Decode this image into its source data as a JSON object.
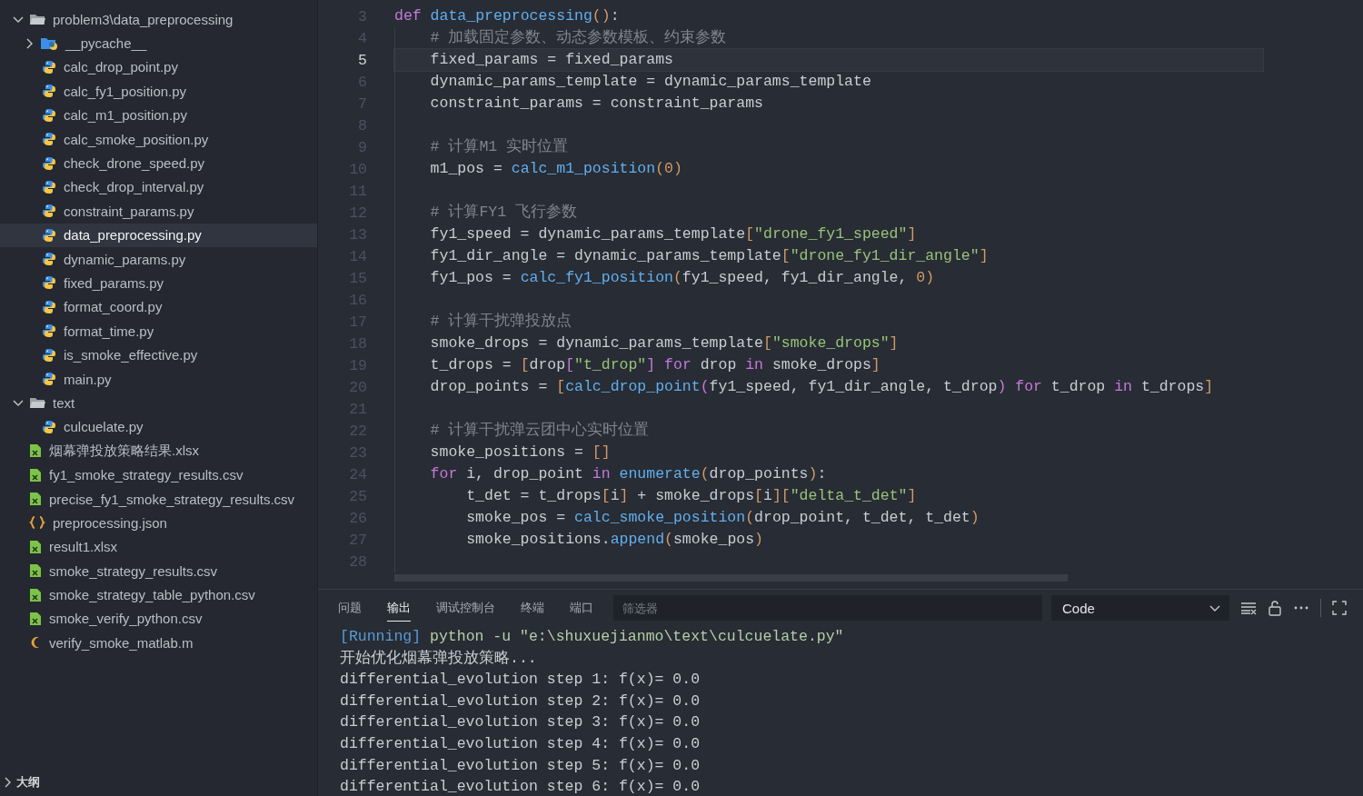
{
  "explorer": {
    "items": [
      {
        "kind": "folder",
        "label": "problem3\\data_preprocessing",
        "expanded": true,
        "selected": false,
        "children": [
          {
            "kind": "python-folder",
            "label": "__pycache__",
            "expanded": false,
            "selected": false
          },
          {
            "kind": "python",
            "label": "calc_drop_point.py",
            "selected": false
          },
          {
            "kind": "python",
            "label": "calc_fy1_position.py",
            "selected": false
          },
          {
            "kind": "python",
            "label": "calc_m1_position.py",
            "selected": false
          },
          {
            "kind": "python",
            "label": "calc_smoke_position.py",
            "selected": false
          },
          {
            "kind": "python",
            "label": "check_drone_speed.py",
            "selected": false
          },
          {
            "kind": "python",
            "label": "check_drop_interval.py",
            "selected": false
          },
          {
            "kind": "python",
            "label": "constraint_params.py",
            "selected": false
          },
          {
            "kind": "python",
            "label": "data_preprocessing.py",
            "selected": true
          },
          {
            "kind": "python",
            "label": "dynamic_params.py",
            "selected": false
          },
          {
            "kind": "python",
            "label": "fixed_params.py",
            "selected": false
          },
          {
            "kind": "python",
            "label": "format_coord.py",
            "selected": false
          },
          {
            "kind": "python",
            "label": "format_time.py",
            "selected": false
          },
          {
            "kind": "python",
            "label": "is_smoke_effective.py",
            "selected": false
          },
          {
            "kind": "python",
            "label": "main.py",
            "selected": false
          }
        ]
      },
      {
        "kind": "folder",
        "label": "text",
        "expanded": true,
        "selected": false,
        "children": [
          {
            "kind": "python",
            "label": "culcuelate.py",
            "selected": false
          }
        ]
      },
      {
        "kind": "excel",
        "label": "烟幕弹投放策略结果.xlsx",
        "selected": false
      },
      {
        "kind": "excel",
        "label": "fy1_smoke_strategy_results.csv",
        "selected": false
      },
      {
        "kind": "excel",
        "label": "precise_fy1_smoke_strategy_results.csv",
        "selected": false
      },
      {
        "kind": "json",
        "label": "preprocessing.json",
        "selected": false
      },
      {
        "kind": "excel",
        "label": "result1.xlsx",
        "selected": false
      },
      {
        "kind": "excel",
        "label": "smoke_strategy_results.csv",
        "selected": false
      },
      {
        "kind": "excel",
        "label": "smoke_strategy_table_python.csv",
        "selected": false
      },
      {
        "kind": "excel",
        "label": "smoke_verify_python.csv",
        "selected": false
      },
      {
        "kind": "matlab",
        "label": "verify_smoke_matlab.m",
        "selected": false
      }
    ],
    "outline": {
      "label": "大纲",
      "expanded": false
    }
  },
  "editor": {
    "lines": [
      {
        "number": "3",
        "current": false,
        "tokens": [
          {
            "kind": "kw",
            "t": "def"
          },
          {
            "kind": "fn",
            "t": " data_preprocessing"
          },
          {
            "kind": "br",
            "t": "()"
          },
          {
            "kind": "pl",
            "t": ":"
          }
        ]
      },
      {
        "number": "4",
        "current": false,
        "tokens": [
          {
            "kind": "cm",
            "t": "    # 加载固定参数、动态参数模板、约束参数"
          }
        ]
      },
      {
        "number": "5",
        "current": true,
        "tokens": [
          {
            "kind": "pl",
            "t": "    fixed_params = fixed_params"
          }
        ]
      },
      {
        "number": "6",
        "current": false,
        "tokens": [
          {
            "kind": "pl",
            "t": "    dynamic_params_template = dynamic_params_template"
          }
        ]
      },
      {
        "number": "7",
        "current": false,
        "tokens": [
          {
            "kind": "pl",
            "t": "    constraint_params = constraint_params"
          }
        ]
      },
      {
        "number": "8",
        "current": false
      },
      {
        "number": "9",
        "current": false,
        "tokens": [
          {
            "kind": "cm",
            "t": "    # 计算M1 实时位置"
          }
        ]
      },
      {
        "number": "10",
        "current": false,
        "tokens": [
          {
            "kind": "pl",
            "t": "    m1_pos = "
          },
          {
            "kind": "fn",
            "t": "calc_m1_position"
          },
          {
            "kind": "br",
            "t": "("
          },
          {
            "kind": "num",
            "t": "0"
          },
          {
            "kind": "br",
            "t": ")"
          }
        ]
      },
      {
        "number": "11",
        "current": false
      },
      {
        "number": "12",
        "current": false,
        "tokens": [
          {
            "kind": "cm",
            "t": "    # 计算FY1 飞行参数"
          }
        ]
      },
      {
        "number": "13",
        "current": false,
        "tokens": [
          {
            "kind": "pl",
            "t": "    fy1_speed = dynamic_params_template"
          },
          {
            "kind": "br",
            "t": "["
          },
          {
            "kind": "str",
            "t": "\"drone_fy1_speed\""
          },
          {
            "kind": "br",
            "t": "]"
          }
        ]
      },
      {
        "number": "14",
        "current": false,
        "tokens": [
          {
            "kind": "pl",
            "t": "    fy1_dir_angle = dynamic_params_template"
          },
          {
            "kind": "br",
            "t": "["
          },
          {
            "kind": "str",
            "t": "\"drone_fy1_dir_angle\""
          },
          {
            "kind": "br",
            "t": "]"
          }
        ]
      },
      {
        "number": "15",
        "current": false,
        "tokens": [
          {
            "kind": "pl",
            "t": "    fy1_pos = "
          },
          {
            "kind": "fn",
            "t": "calc_fy1_position"
          },
          {
            "kind": "br",
            "t": "("
          },
          {
            "kind": "pl",
            "t": "fy1_speed, fy1_dir_angle, "
          },
          {
            "kind": "num",
            "t": "0"
          },
          {
            "kind": "br",
            "t": ")"
          }
        ]
      },
      {
        "number": "16",
        "current": false
      },
      {
        "number": "17",
        "current": false,
        "tokens": [
          {
            "kind": "cm",
            "t": "    # 计算干扰弹投放点"
          }
        ]
      },
      {
        "number": "18",
        "current": false,
        "tokens": [
          {
            "kind": "pl",
            "t": "    smoke_drops = dynamic_params_template"
          },
          {
            "kind": "br",
            "t": "["
          },
          {
            "kind": "str",
            "t": "\"smoke_drops\""
          },
          {
            "kind": "br",
            "t": "]"
          }
        ]
      },
      {
        "number": "19",
        "current": false,
        "tokens": [
          {
            "kind": "pl",
            "t": "    t_drops = "
          },
          {
            "kind": "br",
            "t": "["
          },
          {
            "kind": "pl",
            "t": "drop"
          },
          {
            "kind": "br2",
            "t": "["
          },
          {
            "kind": "str",
            "t": "\"t_drop\""
          },
          {
            "kind": "br2",
            "t": "]"
          },
          {
            "kind": "kw",
            "t": " for"
          },
          {
            "kind": "pl",
            "t": " drop "
          },
          {
            "kind": "kw",
            "t": "in"
          },
          {
            "kind": "pl",
            "t": " smoke_drops"
          },
          {
            "kind": "br",
            "t": "]"
          }
        ]
      },
      {
        "number": "20",
        "current": false,
        "tokens": [
          {
            "kind": "pl",
            "t": "    drop_points = "
          },
          {
            "kind": "br",
            "t": "["
          },
          {
            "kind": "fn",
            "t": "calc_drop_point"
          },
          {
            "kind": "br2",
            "t": "("
          },
          {
            "kind": "pl",
            "t": "fy1_speed, fy1_dir_angle, t_drop"
          },
          {
            "kind": "br2",
            "t": ")"
          },
          {
            "kind": "kw",
            "t": " for"
          },
          {
            "kind": "pl",
            "t": " t_drop "
          },
          {
            "kind": "kw",
            "t": "in"
          },
          {
            "kind": "pl",
            "t": " t_drops"
          },
          {
            "kind": "br",
            "t": "]"
          }
        ]
      },
      {
        "number": "21",
        "current": false
      },
      {
        "number": "22",
        "current": false,
        "tokens": [
          {
            "kind": "cm",
            "t": "    # 计算干扰弹云团中心实时位置"
          }
        ]
      },
      {
        "number": "23",
        "current": false,
        "tokens": [
          {
            "kind": "pl",
            "t": "    smoke_positions = "
          },
          {
            "kind": "br",
            "t": "[]"
          }
        ]
      },
      {
        "number": "24",
        "current": false,
        "tokens": [
          {
            "kind": "kw",
            "t": "    for"
          },
          {
            "kind": "pl",
            "t": " i, drop_point "
          },
          {
            "kind": "kw",
            "t": "in"
          },
          {
            "kind": "fn",
            "t": " enumerate"
          },
          {
            "kind": "br",
            "t": "("
          },
          {
            "kind": "pl",
            "t": "drop_points"
          },
          {
            "kind": "br",
            "t": ")"
          },
          {
            "kind": "pl",
            "t": ":"
          }
        ]
      },
      {
        "number": "25",
        "current": false,
        "tokens": [
          {
            "kind": "pl",
            "t": "        t_det = t_drops"
          },
          {
            "kind": "br",
            "t": "["
          },
          {
            "kind": "pl",
            "t": "i"
          },
          {
            "kind": "br",
            "t": "]"
          },
          {
            "kind": "pl",
            "t": " + smoke_drops"
          },
          {
            "kind": "br",
            "t": "["
          },
          {
            "kind": "pl",
            "t": "i"
          },
          {
            "kind": "br",
            "t": "]["
          },
          {
            "kind": "str",
            "t": "\"delta_t_det\""
          },
          {
            "kind": "br",
            "t": "]"
          }
        ]
      },
      {
        "number": "26",
        "current": false,
        "tokens": [
          {
            "kind": "pl",
            "t": "        smoke_pos = "
          },
          {
            "kind": "fn",
            "t": "calc_smoke_position"
          },
          {
            "kind": "br",
            "t": "("
          },
          {
            "kind": "pl",
            "t": "drop_point, t_det, t_det"
          },
          {
            "kind": "br",
            "t": ")"
          }
        ]
      },
      {
        "number": "27",
        "current": false,
        "tokens": [
          {
            "kind": "pl",
            "t": "        smoke_positions."
          },
          {
            "kind": "fn",
            "t": "append"
          },
          {
            "kind": "br",
            "t": "("
          },
          {
            "kind": "pl",
            "t": "smoke_pos"
          },
          {
            "kind": "br",
            "t": ")"
          }
        ]
      },
      {
        "number": "28",
        "current": false
      }
    ]
  },
  "panel": {
    "tabs": [
      {
        "label": "问题",
        "selected": false
      },
      {
        "label": "输出",
        "selected": true
      },
      {
        "label": "调试控制台",
        "selected": false
      },
      {
        "label": "终端",
        "selected": false
      },
      {
        "label": "端口",
        "selected": false
      }
    ],
    "filter": {
      "placeholder": "筛选器"
    },
    "channel": "Code",
    "output": [
      [
        {
          "kind": "tag",
          "t": "[Running]"
        },
        {
          "kind": "cmd",
          "t": " python -u \"e:\\shuxuejianmo\\text\\culcuelate.py\""
        }
      ],
      [
        {
          "kind": "pl",
          "t": "开始优化烟幕弹投放策略..."
        }
      ],
      [
        {
          "kind": "pl",
          "t": "differential_evolution step 1: f(x)= 0.0"
        }
      ],
      [
        {
          "kind": "pl",
          "t": "differential_evolution step 2: f(x)= 0.0"
        }
      ],
      [
        {
          "kind": "pl",
          "t": "differential_evolution step 3: f(x)= 0.0"
        }
      ],
      [
        {
          "kind": "pl",
          "t": "differential_evolution step 4: f(x)= 0.0"
        }
      ],
      [
        {
          "kind": "pl",
          "t": "differential_evolution step 5: f(x)= 0.0"
        }
      ],
      [
        {
          "kind": "pl",
          "t": "differential_evolution step 6: f(x)= 0.0"
        }
      ]
    ]
  }
}
